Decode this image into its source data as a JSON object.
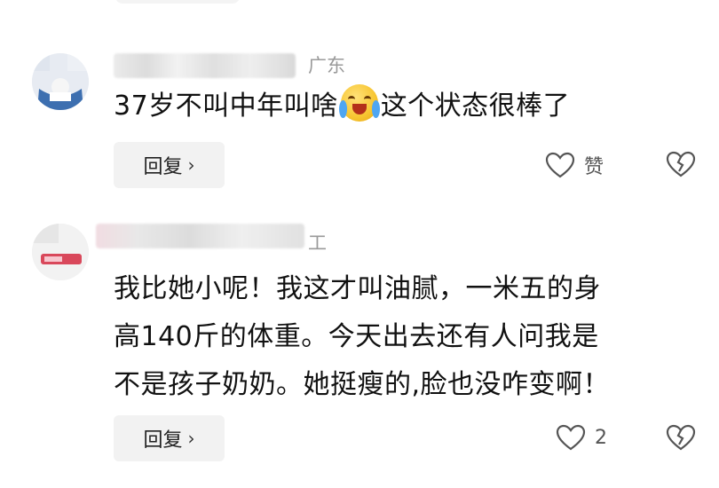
{
  "comments": [
    {
      "location": "广东",
      "text": "37岁不叫中年叫啥",
      "emoji": "crying-laughing-emoji",
      "text_after": "这个状态很棒了",
      "reply_label": "回复",
      "reply_chevron": "›",
      "like_label": "赞"
    },
    {
      "location": "工",
      "text_lines": [
        "我比她小呢！我这才叫油腻，一米五的身",
        "高140斤的体重。今天出去还有人问我是",
        "不是孩子奶奶。她挺瘦的,脸也没咋变啊！"
      ],
      "reply_label": "回复",
      "reply_chevron": "›",
      "like_count": "2"
    }
  ],
  "colors": {
    "text": "#111111",
    "meta": "#9a9a9a",
    "reply_bg": "#f2f2f2",
    "icon": "#555555"
  },
  "icons": [
    "heart-icon",
    "broken-heart-icon",
    "chevron-right-icon"
  ]
}
